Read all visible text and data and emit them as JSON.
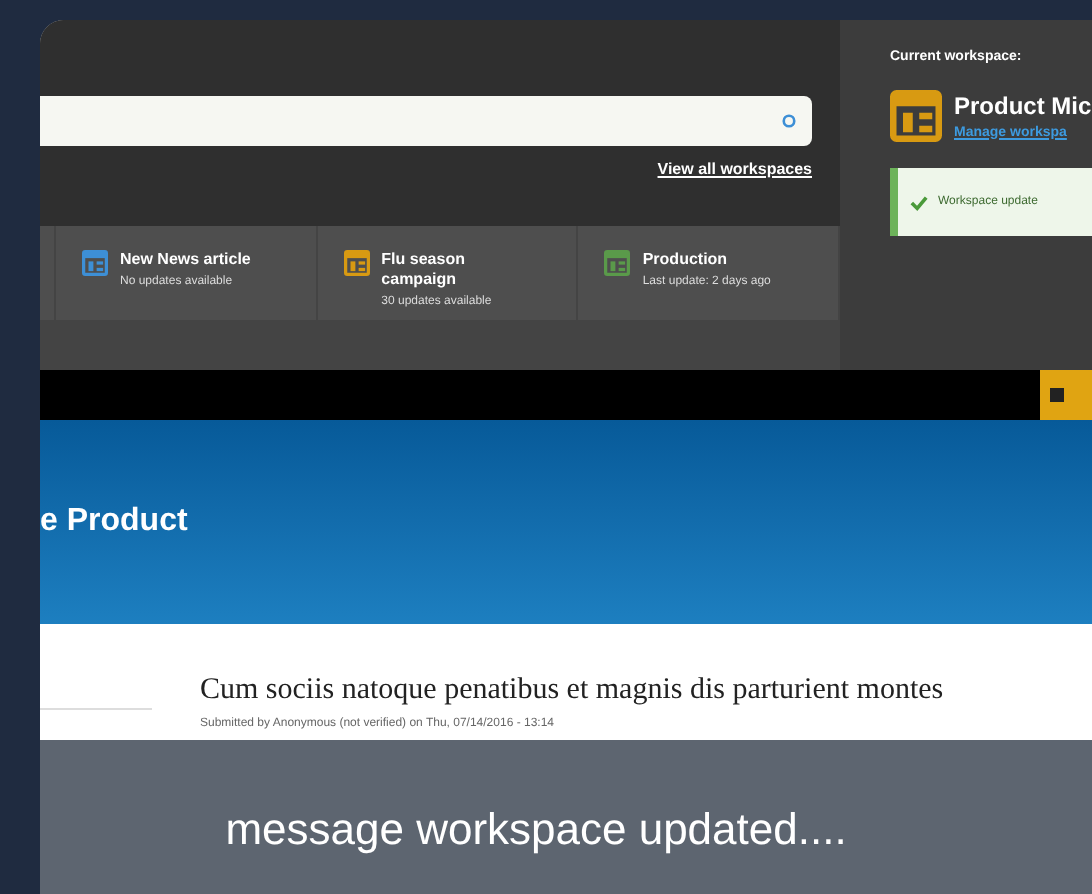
{
  "workspace_switcher": {
    "view_all_link": "View all workspaces",
    "workspaces": [
      {
        "name": "New News article",
        "status": "No updates available",
        "color": "#3d8fd6"
      },
      {
        "name": "Flu season campaign",
        "status": "30 updates available",
        "color": "#d89a12"
      },
      {
        "name": "Production",
        "status": "Last update: 2 days ago",
        "color": "#5a9a4a"
      }
    ]
  },
  "current_workspace": {
    "label": "Current workspace:",
    "name": "Product Mic",
    "manage_link": "Manage workspa",
    "message": "Workspace update"
  },
  "site": {
    "banner_title": "e Product",
    "article": {
      "title": "Cum sociis natoque penatibus et magnis dis parturient montes",
      "meta": "Submitted by Anonymous (not verified) on Thu, 07/14/2016 - 13:14"
    }
  },
  "caption": "message workspace updated...."
}
